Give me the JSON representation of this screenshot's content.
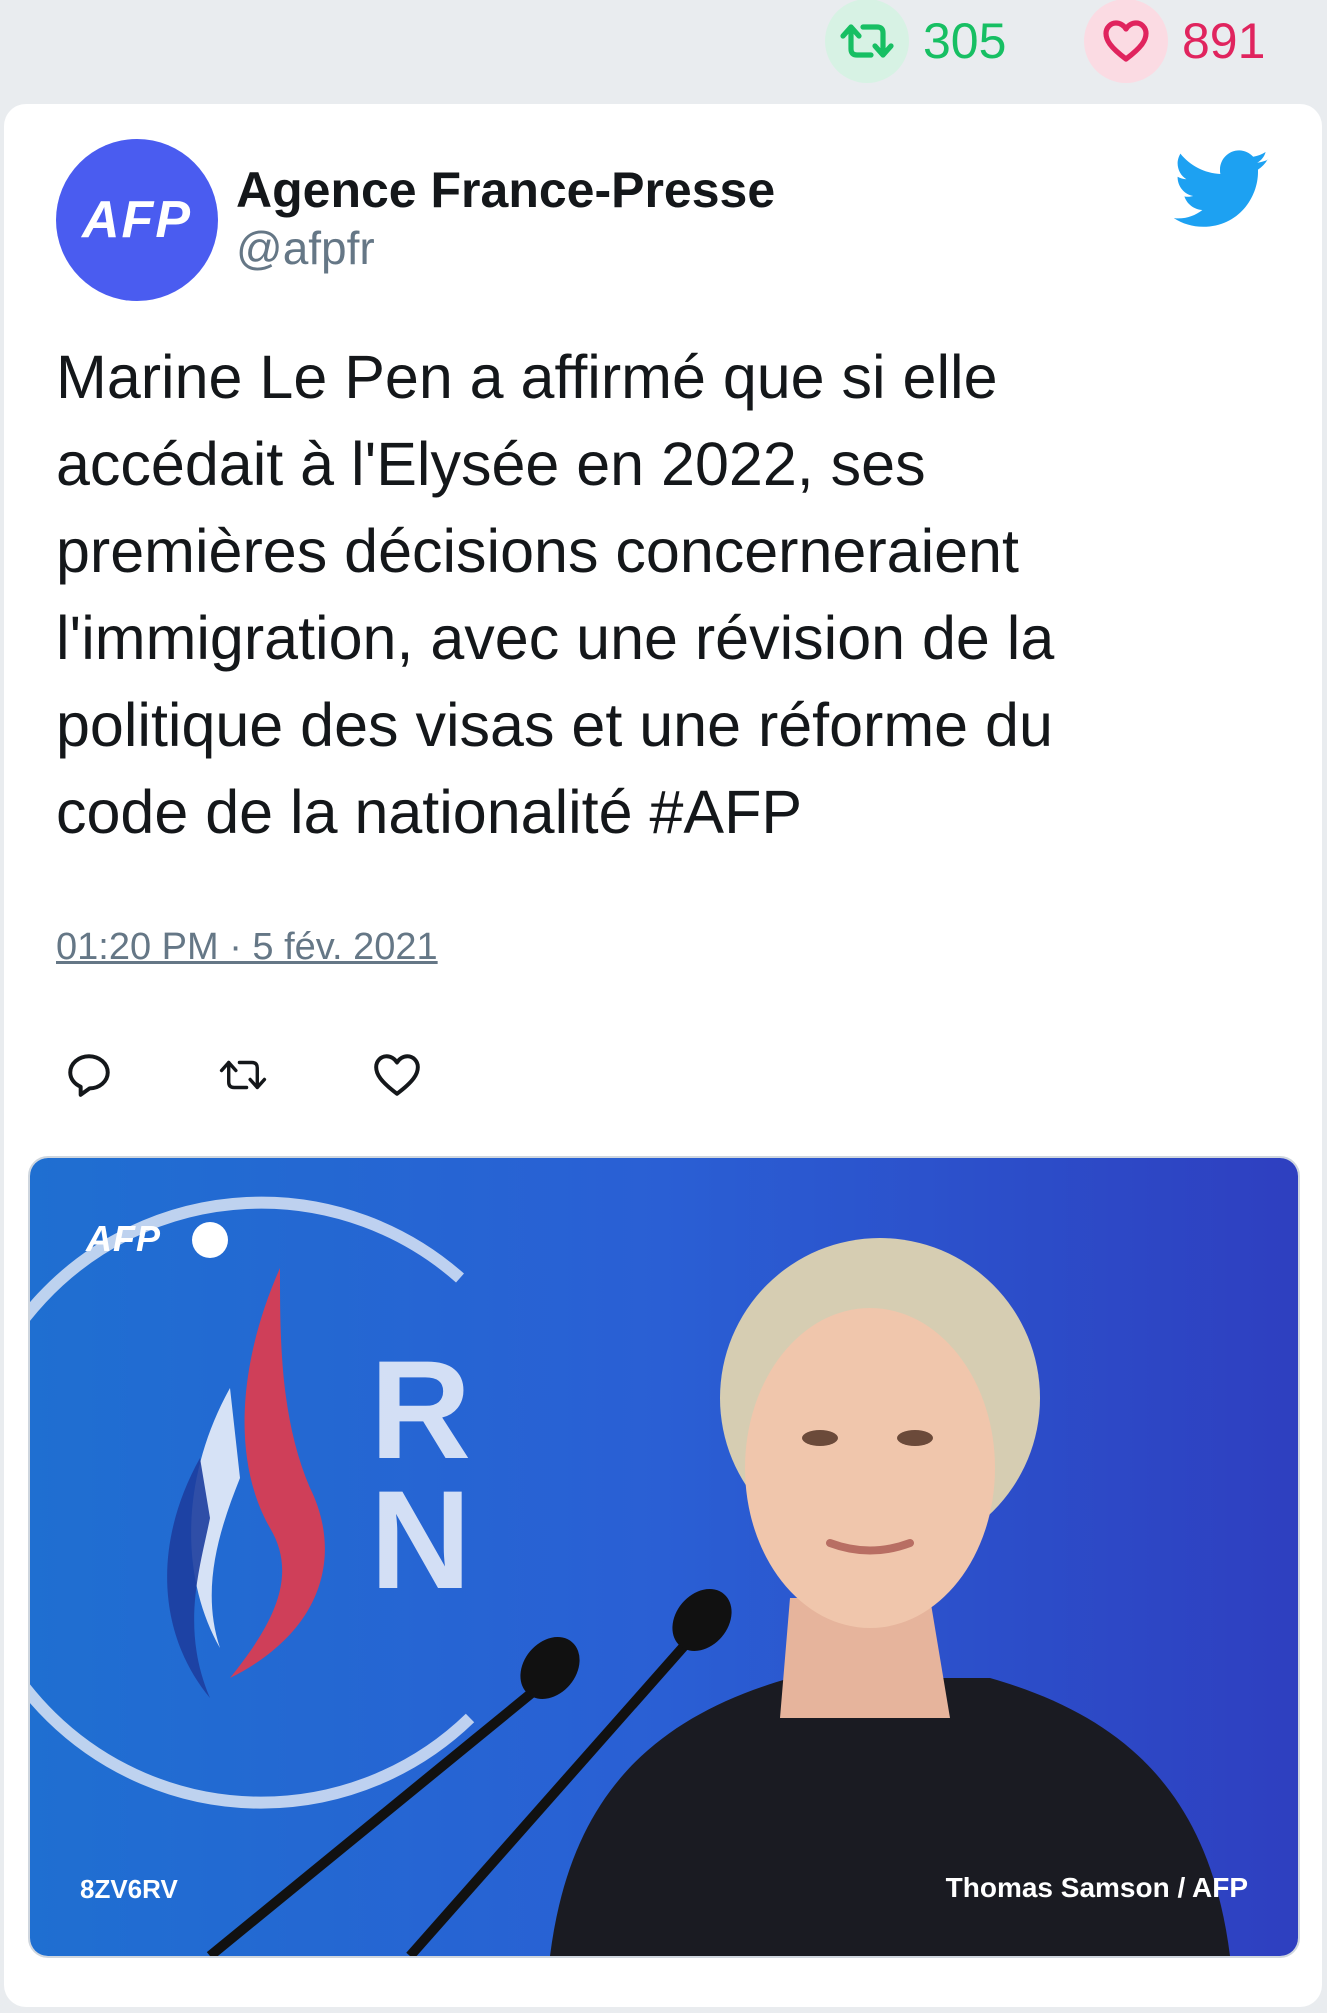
{
  "counters": {
    "retweets": "305",
    "likes": "891",
    "retweet_color": "#17bf63",
    "like_color": "#e0245e"
  },
  "author": {
    "name": "Agence France-Presse",
    "handle": "@afpfr",
    "avatar_text": "AFP"
  },
  "tweet": {
    "lines": [
      "Marine Le Pen a affirmé que si elle",
      "accédait à l'Elysée en 2022, ses",
      "premières décisions concerneraient",
      "l'immigration, avec une révision de la",
      "politique des visas et une réforme du",
      "code de la nationalité #AFP"
    ],
    "timestamp": "01:20 PM · 5 fév. 2021"
  },
  "icons": {
    "brand": "twitter-bird-icon",
    "actions": [
      "reply-icon",
      "retweet-icon",
      "like-icon"
    ]
  },
  "media": {
    "watermark": "AFP",
    "logo_letters": "RN",
    "photo_code": "8ZV6RV",
    "credit": "Thomas Samson / AFP"
  }
}
